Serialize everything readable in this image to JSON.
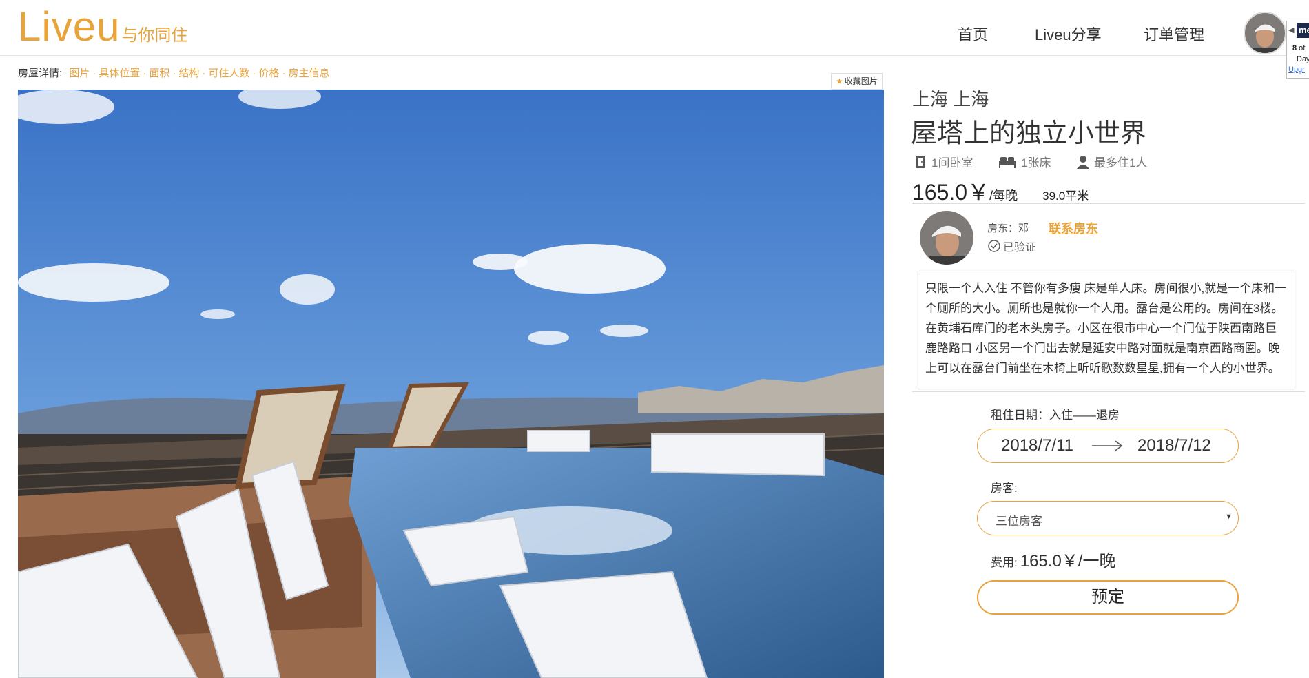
{
  "brand": {
    "name": "Liveu",
    "tagline": "与你同住",
    "color": "#e8a33a"
  },
  "nav": {
    "items": [
      "首页",
      "Liveu分享",
      "订单管理"
    ]
  },
  "extension": {
    "badge": "me",
    "count": "8",
    "count_suffix": " of",
    "days": "Day",
    "upgrade": "Upgr"
  },
  "details_nav": {
    "label": "房屋详情:",
    "links": [
      "图片",
      "具体位置",
      "面积",
      "结构",
      "可住人数",
      "价格",
      "房主信息"
    ]
  },
  "favorite": {
    "label": "收藏图片",
    "icon": "star-icon"
  },
  "listing": {
    "city": "上海 上海",
    "title": "屋塔上的独立小世界",
    "bedrooms": "1间卧室",
    "beds": "1张床",
    "max_guests": "最多住1人",
    "price": "165.0￥",
    "price_unit": "/每晚",
    "area": "39.0平米"
  },
  "host": {
    "name": "房东：邓",
    "contact_label": "联系房东",
    "verified": "已验证"
  },
  "description": "只限一个人入住  不管你有多瘦  床是单人床。房间很小,就是一个床和一个厕所的大小。厕所也是就你一个人用。露台是公用的。房间在3楼。在黄埔石库门的老木头房子。小区在很市中心一个门位于陕西南路巨鹿路路口 小区另一个门出去就是延安中路对面就是南京西路商圈。晚上可以在露台门前坐在木椅上听听歌数数星星,拥有一个人的小世界。",
  "booking": {
    "date_label": "租住日期：入住——退房",
    "check_in": "2018/7/11",
    "check_out": "2018/7/12",
    "guest_label": "房客:",
    "guest_value": "三位房客",
    "fee_label": "费用:",
    "fee_value": "165.0￥/一晚",
    "book_label": "预定"
  }
}
